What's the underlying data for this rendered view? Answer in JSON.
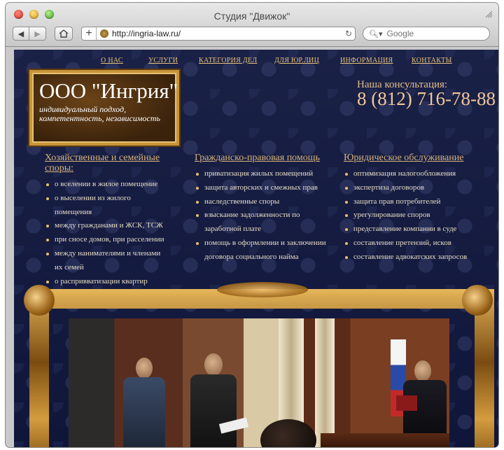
{
  "browser": {
    "title": "Студия \"Движок\"",
    "url": "http://ingria-law.ru/",
    "search_placeholder": "Google"
  },
  "nav": [
    {
      "label": "О НАС"
    },
    {
      "label": "УСЛУГИ"
    },
    {
      "label": "КАТЕГОРИЯ ДЕЛ"
    },
    {
      "label": "ДЛЯ ЮР.ЛИЦ"
    },
    {
      "label": "ИНФОРМАЦИЯ"
    },
    {
      "label": "КОНТАКТЫ"
    }
  ],
  "logo": {
    "name": "ООО \"Ингрия\"",
    "tagline": "индивидуальный подход, компетентность, независимость"
  },
  "consultation": {
    "label": "Наша консультация:",
    "phone": "8 (812) 716-78-88"
  },
  "columns": [
    {
      "title": "Хозяйственные и семейные споры:",
      "items": [
        "о вселении в жилое помещение",
        "о выселении из жилого помещения",
        "между гражданами и ЖСК, ТСЖ",
        "при сносе домов, при расселении",
        "между нанимателями и членами их семей",
        "о распривватизации квартир"
      ]
    },
    {
      "title": "Гражданско-правовая помощь",
      "items": [
        "приватизация жилых помещений",
        "защита авторских и смежных прав",
        "наследственные споры",
        "взыскание задолженности по заработной плате",
        "помощь в оформлении и заключении договора социального найма"
      ]
    },
    {
      "title": "Юридическое обслуживание",
      "items": [
        "оптимизация налогообложения",
        "экспертиза договоров",
        "защита прав потребителей",
        "урегулирование споров",
        "представление компании в суде",
        "составление претензий, исков",
        "составление адвокатских запросов"
      ]
    }
  ]
}
